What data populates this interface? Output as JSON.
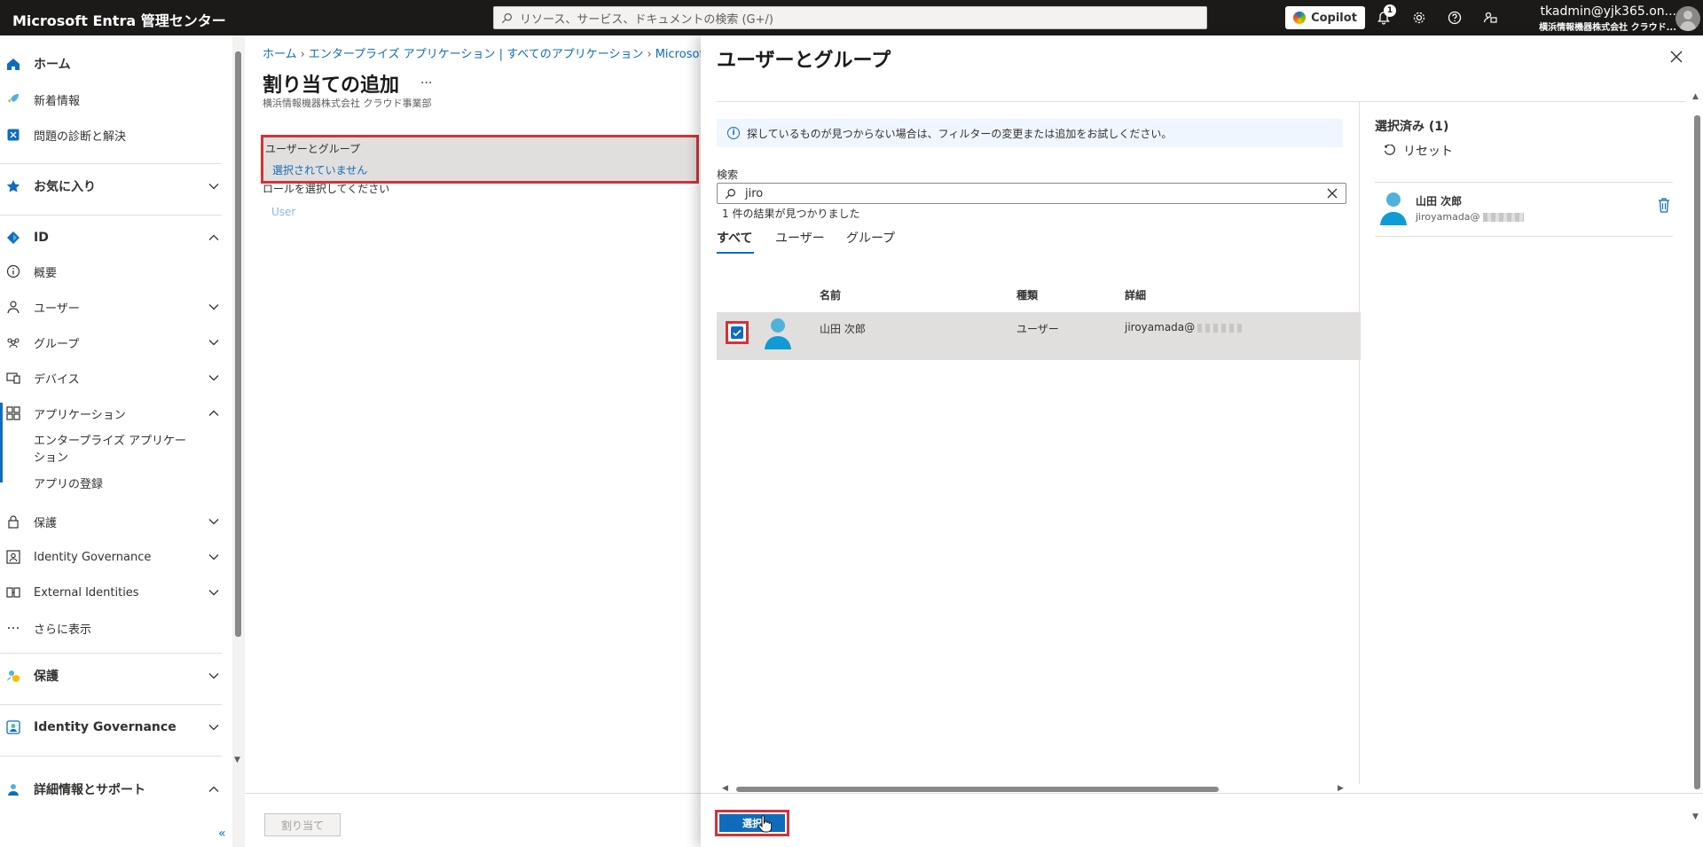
{
  "topbar": {
    "brand": "Microsoft Entra 管理センター",
    "search_placeholder": "リソース、サービス、ドキュメントの検索 (G+/)",
    "copilot_label": "Copilot",
    "notification_count": "1",
    "account_email": "tkadmin@yjk365.on...",
    "account_org": "横浜情報機器株式会社 クラウド..."
  },
  "sidebar": {
    "home": "ホーム",
    "whats_new": "新着情報",
    "diagnose": "問題の診断と解決",
    "favorites": "お気に入り",
    "identity": "ID",
    "overview": "概要",
    "users": "ユーザー",
    "groups": "グループ",
    "devices": "デバイス",
    "applications": "アプリケーション",
    "enterprise_apps": "エンタープライズ アプリケーション",
    "app_registrations": "アプリの登録",
    "protection": "保護",
    "identity_governance": "Identity Governance",
    "external_identities": "External Identities",
    "show_more": "さらに表示",
    "protection_section": "保護",
    "identity_governance_section": "Identity Governance",
    "learn_support": "詳細情報とサポート",
    "collapse": "«"
  },
  "main": {
    "breadcrumb": [
      "ホーム",
      "エンタープライズ アプリケーション | すべてのアプリケーション",
      "Microsoft Entra"
    ],
    "title": "割り当ての追加",
    "more": "...",
    "subtitle": "横浜情報機器株式会社 クラウド事業部",
    "users_groups_label": "ユーザーとグループ",
    "users_groups_value": "選択されていません",
    "role_label": "ロールを選択してください",
    "role_value": "User",
    "assign_button": "割り当て"
  },
  "panel": {
    "title": "ユーザーとグループ",
    "info_text": "探しているものが見つからない場合は、フィルターの変更または追加をお試しください。",
    "search_label": "検索",
    "search_value": "jiro",
    "result_count": "1 件の結果が見つかりました",
    "tabs": [
      {
        "label": "すべて"
      },
      {
        "label": "ユーザー"
      },
      {
        "label": "グループ"
      }
    ],
    "columns": [
      "名前",
      "種類",
      "詳細"
    ],
    "rows": [
      {
        "name": "山田 次郎",
        "type": "ユーザー",
        "detail": "jiroyamada@"
      }
    ],
    "selected_title": "選択済み (1)",
    "reset_label": "リセット",
    "selected_items": [
      {
        "name": "山田 次郎",
        "email": "jiroyamada@"
      }
    ],
    "select_button": "選択"
  },
  "colors": {
    "accent": "#0f6cbd",
    "highlight_border": "#d13438",
    "topbar_bg": "#1b1a19"
  }
}
